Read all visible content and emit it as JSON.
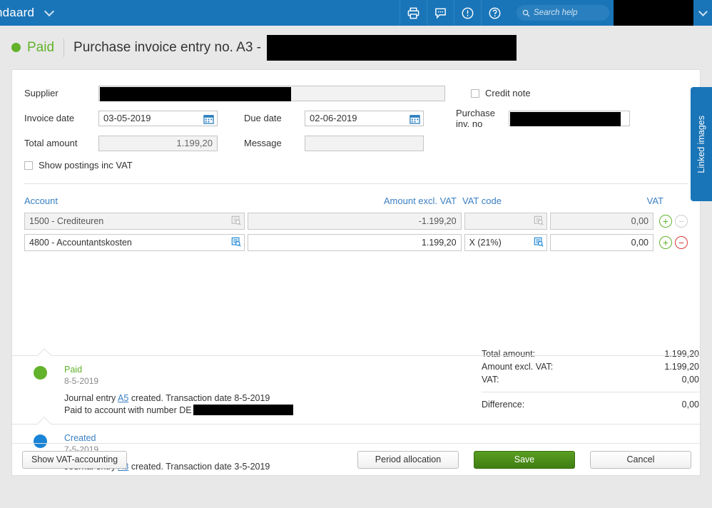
{
  "topbar": {
    "company": "ndaard",
    "icons": [
      "print-icon",
      "chat-icon",
      "alert-icon",
      "help-icon"
    ],
    "search_placeholder": "Search help"
  },
  "header": {
    "status": "Paid",
    "status_color": "#62b22b",
    "title": "Purchase invoice entry no. A3 -"
  },
  "form": {
    "supplier_label": "Supplier",
    "supplier_value": "",
    "invoice_date_label": "Invoice date",
    "invoice_date_value": "03-05-2019",
    "due_date_label": "Due date",
    "due_date_value": "02-06-2019",
    "total_amount_label": "Total amount",
    "total_amount_value": "1.199,20",
    "message_label": "Message",
    "message_value": "",
    "credit_note_label": "Credit note",
    "purchase_inv_no_label": "Purchase inv. no",
    "purchase_inv_no_value": "",
    "show_postings_label": "Show postings inc VAT"
  },
  "table": {
    "headers": {
      "account": "Account",
      "amount_excl_vat": "Amount excl. VAT",
      "vat_code": "VAT code",
      "vat": "VAT"
    },
    "rows": [
      {
        "account": "1500 - Crediteuren",
        "amount_excl_vat": "-1.199,20",
        "vat_code": "",
        "vat": "0,00",
        "add_label": "+",
        "remove_label": "−",
        "readonly": true
      },
      {
        "account": "4800 - Accountantskosten",
        "amount_excl_vat": "1.199,20",
        "vat_code": "X (21%)",
        "vat": "0,00",
        "add_label": "+",
        "remove_label": "−",
        "readonly": false
      }
    ]
  },
  "totals": {
    "total_amount_label": "Total amount:",
    "total_amount_value": "1.199,20",
    "amount_excl_vat_label": "Amount excl. VAT:",
    "amount_excl_vat_value": "1.199,20",
    "vat_label": "VAT:",
    "vat_value": "0,00",
    "difference_label": "Difference:",
    "difference_value": "0,00"
  },
  "timeline": [
    {
      "status": "Paid",
      "date": "8-5-2019",
      "line1_before": "Journal entry ",
      "line1_link": "A5",
      "line1_after": " created. Transaction date 8-5-2019",
      "line2": "Paid to account with number DE",
      "color": "green"
    },
    {
      "status": "Created",
      "date": "7-5-2019",
      "line1_before": "Journal entry ",
      "line1_link": "A3",
      "line1_after": " created. Transaction date 3-5-2019",
      "line2": "",
      "color": "blue"
    }
  ],
  "footer": {
    "show_vat_accounting": "Show VAT-accounting",
    "period_allocation": "Period allocation",
    "save": "Save",
    "cancel": "Cancel"
  },
  "side_tab": {
    "linked_images": "Linked images"
  }
}
